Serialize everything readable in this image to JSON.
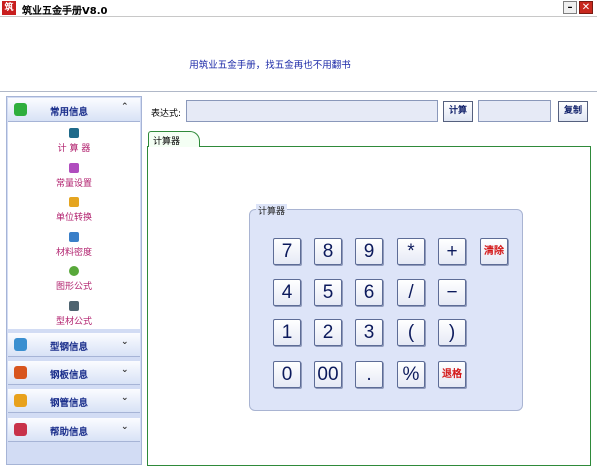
{
  "window": {
    "title": "筑业五金手册V8.0",
    "icon_text": "筑",
    "minimize_glyph": "–",
    "close_glyph": "✕"
  },
  "banner": {
    "slogan": "用筑业五金手册，找五金再也不用翻书"
  },
  "sidebar": {
    "sections": [
      {
        "label": "常用信息",
        "icon": "globe-icon",
        "expanded": true,
        "chevron": "⌃"
      },
      {
        "label": "型钢信息",
        "icon": "steel-icon",
        "chevron": "⌄"
      },
      {
        "label": "钢板信息",
        "icon": "plate-icon",
        "chevron": "⌄"
      },
      {
        "label": "钢管信息",
        "icon": "pipe-icon",
        "chevron": "⌄"
      },
      {
        "label": "帮助信息",
        "icon": "help-icon",
        "chevron": "⌄"
      }
    ],
    "items": [
      {
        "label": "计 算 器",
        "icon": "calculator-icon"
      },
      {
        "label": "常量设置",
        "icon": "constants-icon"
      },
      {
        "label": "单位转换",
        "icon": "unit-convert-icon"
      },
      {
        "label": "材料密度",
        "icon": "density-icon"
      },
      {
        "label": "图形公式",
        "icon": "shape-formula-icon"
      },
      {
        "label": "型材公式",
        "icon": "profile-formula-icon"
      }
    ]
  },
  "toolbar": {
    "expression_label": "表达式:",
    "expression_value": "",
    "calc_label": "计算",
    "result_value": "",
    "copy_label": "复制"
  },
  "tab": {
    "label": "计算器"
  },
  "calculator": {
    "group_title": "计算器",
    "keys": [
      [
        "7",
        "8",
        "9",
        "*",
        "+",
        "清除"
      ],
      [
        "4",
        "5",
        "6",
        "/",
        "−"
      ],
      [
        "1",
        "2",
        "3",
        "(",
        ")"
      ],
      [
        "0",
        "00",
        ".",
        "%",
        "退格"
      ]
    ]
  },
  "colors": {
    "slogan": "#1c2aa8",
    "nav_item_text": "#b01e6c",
    "nav_header_text": "#1b2f8c",
    "action_key_text": "#d41818",
    "tab_border": "#2f8a3a"
  }
}
